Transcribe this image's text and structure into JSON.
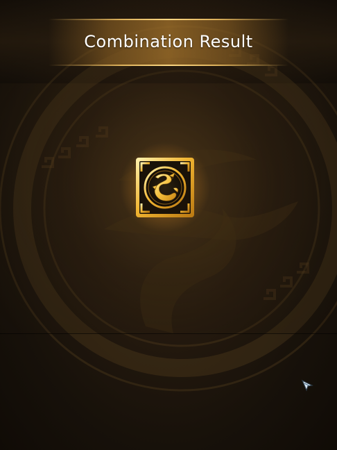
{
  "header": {
    "title": "Combination Result"
  },
  "result": {
    "item_icon": "golden-dragon-emblem-icon"
  },
  "colors": {
    "accent_gold": "#f6c95a",
    "background_dark": "#17110a",
    "title_text": "#ffffff"
  }
}
